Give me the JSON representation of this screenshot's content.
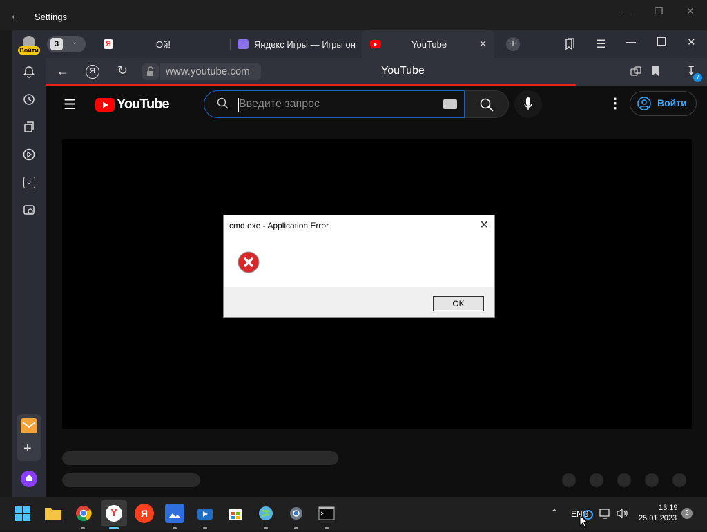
{
  "settings_window": {
    "title": "Settings"
  },
  "browser": {
    "account_label": "Войти",
    "tab_counter": "3",
    "tabs": [
      {
        "label": "Ой!"
      },
      {
        "label": "Яндекс Игры — Игры он"
      },
      {
        "label": "YouTube"
      }
    ],
    "address": "www.youtube.com",
    "page_title": "YouTube",
    "downloads_badge": "7",
    "sidebar_tab_count": "3"
  },
  "youtube": {
    "logo_text": "YouTube",
    "search_placeholder": "Введите запрос",
    "signin_label": "Войти"
  },
  "dialog": {
    "title": "cmd.exe - Application Error",
    "ok_label": "OK"
  },
  "taskbar": {
    "language": "ENG",
    "time": "13:19",
    "date": "25.01.2023",
    "notification_count": "2"
  },
  "colors": {
    "youtube_red": "#ff0000",
    "progress_red": "#e62117",
    "alice_purple": "#8a3ffc",
    "link_blue": "#3ea6ff"
  }
}
